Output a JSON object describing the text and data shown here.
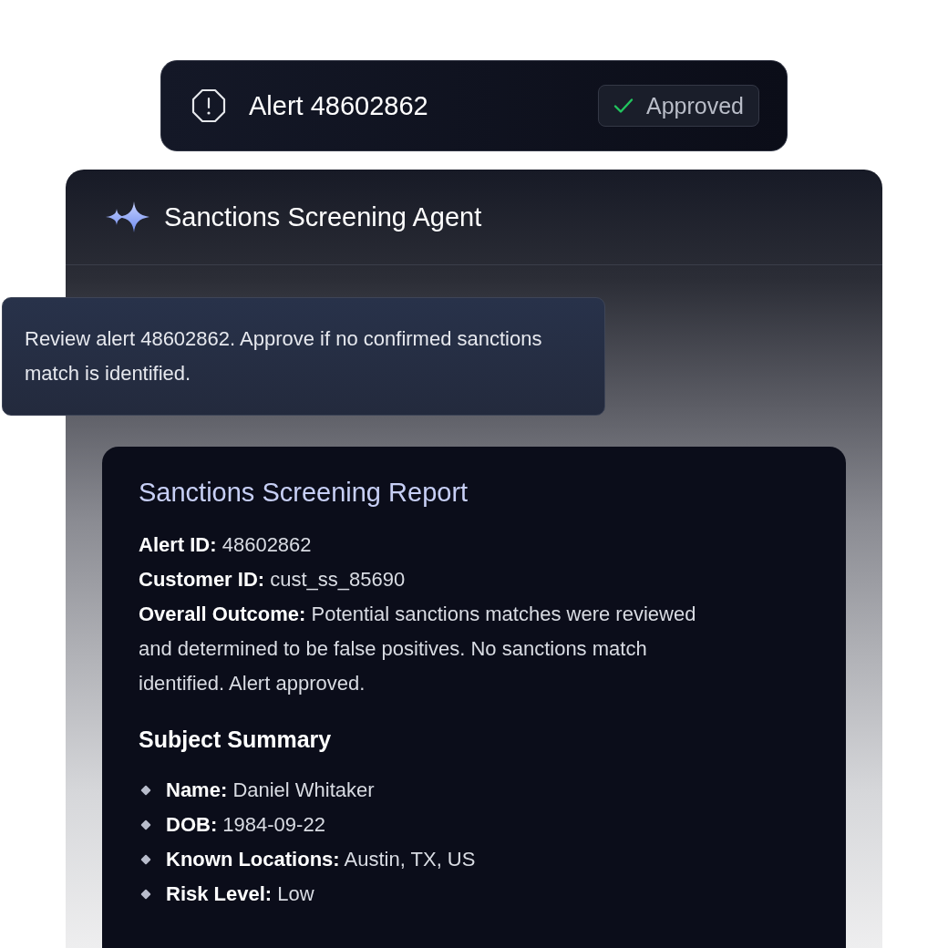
{
  "alert": {
    "title": "Alert 48602862",
    "status": {
      "kind": "approved",
      "label": "Approved"
    }
  },
  "agent": {
    "title": "Sanctions Screening Agent"
  },
  "message": {
    "text": "Review alert 48602862. Approve if no confirmed sanctions match is identified."
  },
  "report": {
    "title": "Sanctions Screening Report",
    "fields": [
      {
        "label": "Alert ID:",
        "value": "48602862"
      },
      {
        "label": "Customer ID:",
        "value": "cust_ss_85690"
      },
      {
        "label": "Overall Outcome:",
        "value": "Potential sanctions matches were reviewed and determined to be false positives. No sanctions match identified. Alert approved."
      }
    ],
    "section_title": "Subject Summary",
    "subject": [
      {
        "label": "Name:",
        "value": "Daniel Whitaker"
      },
      {
        "label": "DOB:",
        "value": "1984-09-22"
      },
      {
        "label": "Known Locations:",
        "value": "Austin, TX, US"
      },
      {
        "label": "Risk Level:",
        "value": "Low"
      }
    ]
  }
}
